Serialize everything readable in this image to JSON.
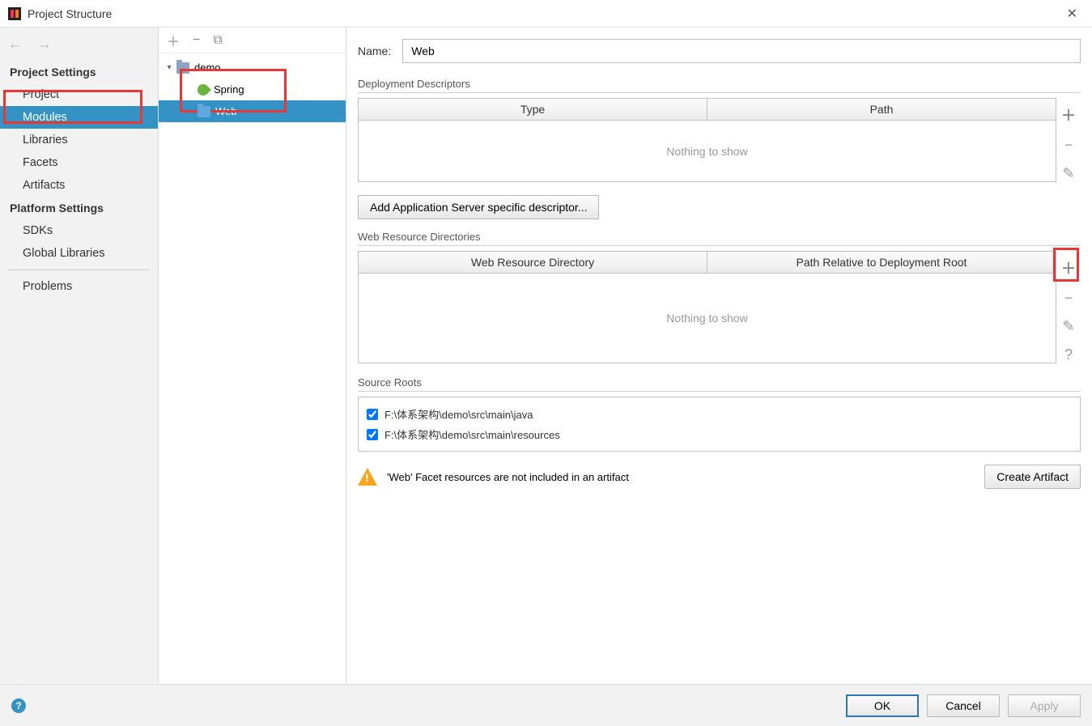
{
  "window": {
    "title": "Project Structure"
  },
  "sidebar": {
    "section1": "Project Settings",
    "items1": [
      "Project",
      "Modules",
      "Libraries",
      "Facets",
      "Artifacts"
    ],
    "section2": "Platform Settings",
    "items2": [
      "SDKs",
      "Global Libraries"
    ],
    "problems": "Problems"
  },
  "tree": {
    "root": "demo",
    "children": [
      {
        "label": "Spring",
        "icon": "spring"
      },
      {
        "label": "Web",
        "icon": "web"
      }
    ]
  },
  "right": {
    "name_label": "Name:",
    "name_value": "Web",
    "dd_section": "Deployment Descriptors",
    "dd_headers": [
      "Type",
      "Path"
    ],
    "nothing": "Nothing to show",
    "add_desc_btn": "Add Application Server specific descriptor...",
    "wrd_section": "Web Resource Directories",
    "wrd_headers": [
      "Web Resource Directory",
      "Path Relative to Deployment Root"
    ],
    "source_section": "Source Roots",
    "source_roots": [
      "F:\\体系架构\\demo\\src\\main\\java",
      "F:\\体系架构\\demo\\src\\main\\resources"
    ],
    "warning": "'Web' Facet resources are not included in an artifact",
    "create_artifact": "Create Artifact"
  },
  "footer": {
    "ok": "OK",
    "cancel": "Cancel",
    "apply": "Apply"
  }
}
